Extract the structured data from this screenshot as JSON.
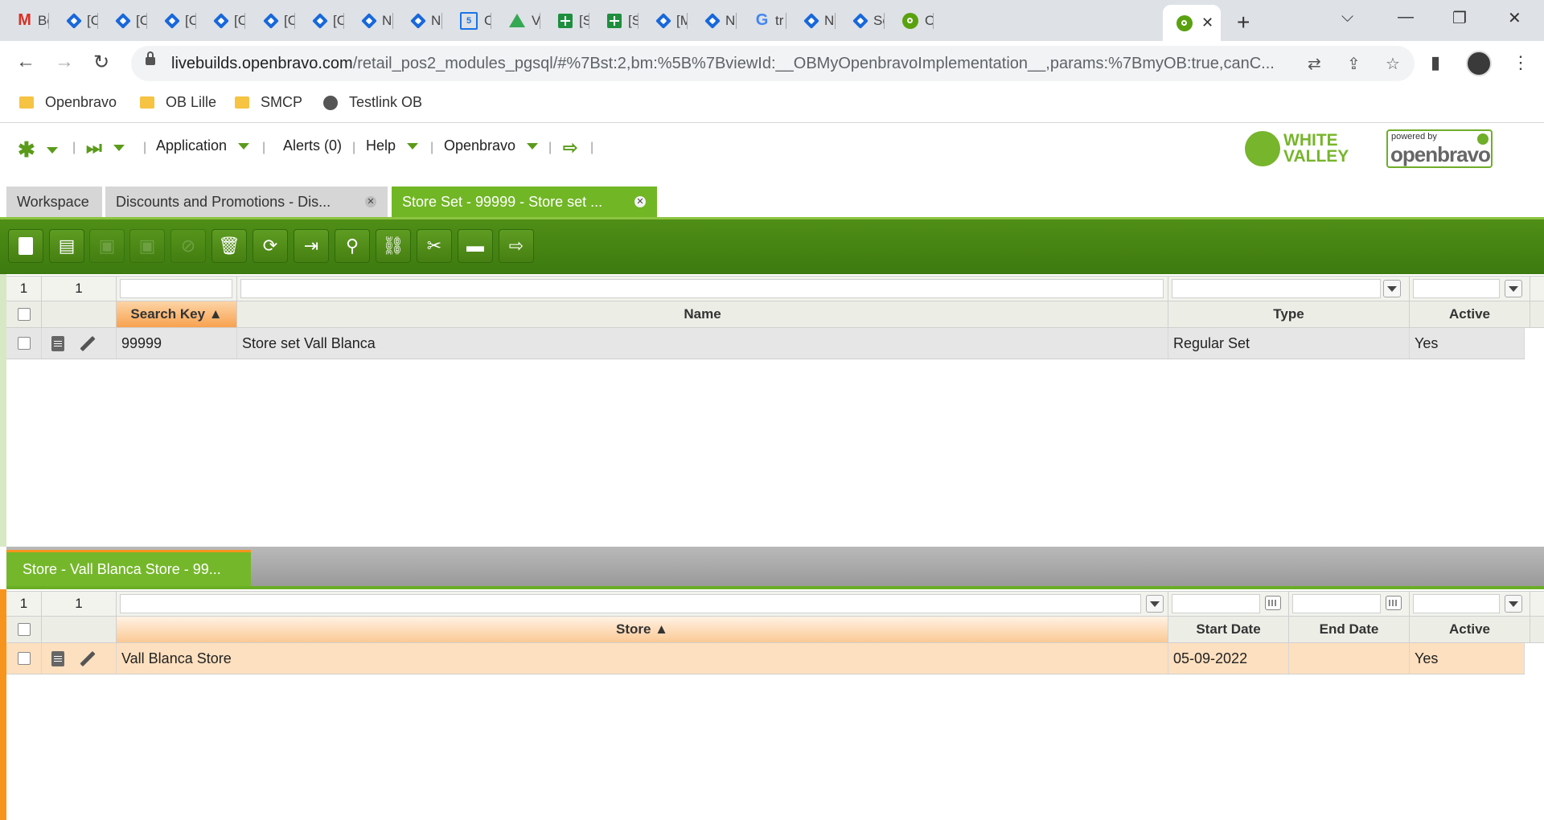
{
  "browser": {
    "tabs": [
      {
        "icon": "gmail-icon",
        "label": "Bc"
      },
      {
        "icon": "jira-icon",
        "label": "[C"
      },
      {
        "icon": "jira-icon",
        "label": "[C"
      },
      {
        "icon": "jira-icon",
        "label": "[C"
      },
      {
        "icon": "jira-icon",
        "label": "[C"
      },
      {
        "icon": "jira-icon",
        "label": "[C"
      },
      {
        "icon": "jira-icon",
        "label": "[C"
      },
      {
        "icon": "jira-icon",
        "label": "N"
      },
      {
        "icon": "jira-icon",
        "label": "N"
      },
      {
        "icon": "calendar-icon",
        "label": "O"
      },
      {
        "icon": "drive-icon",
        "label": "Vi"
      },
      {
        "icon": "sheets-icon",
        "label": "[S"
      },
      {
        "icon": "sheets-icon",
        "label": "[S"
      },
      {
        "icon": "jira-icon",
        "label": "[M"
      },
      {
        "icon": "jira-icon",
        "label": "N"
      },
      {
        "icon": "google-icon",
        "label": "tr"
      },
      {
        "icon": "jira-icon",
        "label": "N"
      },
      {
        "icon": "jira-icon",
        "label": "Sé"
      },
      {
        "icon": "openbravo-icon",
        "label": "O"
      }
    ],
    "active_tab_close": "✕",
    "url_host": "livebuilds.openbravo.com",
    "url_rest": "/retail_pos2_modules_pgsql/#%7Bst:2,bm:%5B%7BviewId:__OBMyOpenbravoImplementation__,params:%7BmyOB:true,canC...",
    "bookmarks": [
      {
        "icon": "folder-icon",
        "label": "Openbravo"
      },
      {
        "icon": "folder-icon",
        "label": "OB Lille"
      },
      {
        "icon": "folder-icon",
        "label": "SMCP"
      },
      {
        "icon": "globe-icon",
        "label": "Testlink OB"
      }
    ]
  },
  "menu": {
    "application": "Application",
    "alerts": "Alerts (0)",
    "help": "Help",
    "openbravo": "Openbravo",
    "logo_white_valley_1": "WHITE",
    "logo_white_valley_2": "VALLEY",
    "logo_powered_by": "powered by",
    "logo_openbravo": "openbravo"
  },
  "window_tabs": [
    {
      "label": "Workspace"
    },
    {
      "label": "Discounts and Promotions - Dis..."
    },
    {
      "label": "Store Set - 99999 - Store set ..."
    }
  ],
  "toolbar": {
    "buttons": [
      "new-document",
      "new-row",
      "save",
      "save-close",
      "undo",
      "delete",
      "refresh",
      "export",
      "attachments",
      "link",
      "customize",
      "grid-form-toggle",
      "process"
    ]
  },
  "header_grid": {
    "counts": [
      "1",
      "1"
    ],
    "columns": {
      "search_key": "Search Key ▲",
      "name": "Name",
      "type": "Type",
      "active": "Active"
    },
    "rows": [
      {
        "search_key": "99999",
        "name": "Store set Vall Blanca",
        "type": "Regular Set",
        "active": "Yes"
      }
    ]
  },
  "subtab": {
    "label": "Store - Vall Blanca Store - 99..."
  },
  "lines_grid": {
    "counts": [
      "1",
      "1"
    ],
    "columns": {
      "store": "Store ▲",
      "start_date": "Start Date",
      "end_date": "End Date",
      "active": "Active"
    },
    "rows": [
      {
        "store": "Vall Blanca Store",
        "start_date": "05-09-2022",
        "end_date": "",
        "active": "Yes"
      }
    ]
  },
  "colors": {
    "brand_green": "#71b625",
    "toolbar_green": "#4f8e16",
    "accent_orange": "#f7941d"
  }
}
